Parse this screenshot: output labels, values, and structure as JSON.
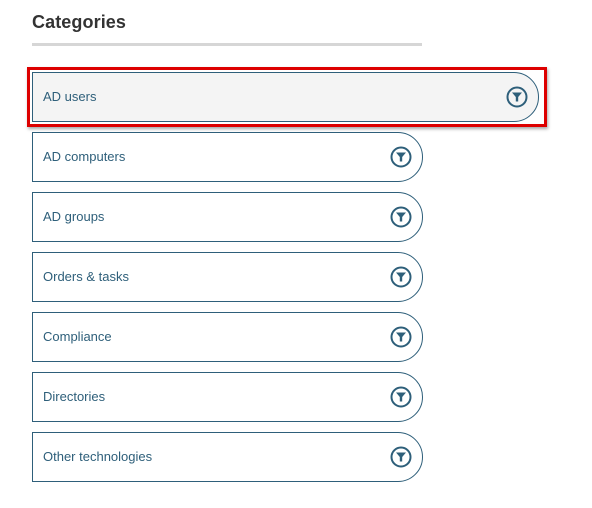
{
  "panel": {
    "title": "Categories"
  },
  "categories": [
    {
      "label": "AD users",
      "icon": "filter-icon",
      "selected": true
    },
    {
      "label": "AD computers",
      "icon": "filter-icon",
      "selected": false
    },
    {
      "label": "AD groups",
      "icon": "filter-icon",
      "selected": false
    },
    {
      "label": "Orders & tasks",
      "icon": "filter-icon",
      "selected": false
    },
    {
      "label": "Compliance",
      "icon": "filter-icon",
      "selected": false
    },
    {
      "label": "Directories",
      "icon": "filter-icon",
      "selected": false
    },
    {
      "label": "Other technologies",
      "icon": "filter-icon",
      "selected": false
    }
  ],
  "colors": {
    "accent": "#2e5f7a",
    "highlight": "#dd0000",
    "selected_bg": "#f4f4f4"
  }
}
